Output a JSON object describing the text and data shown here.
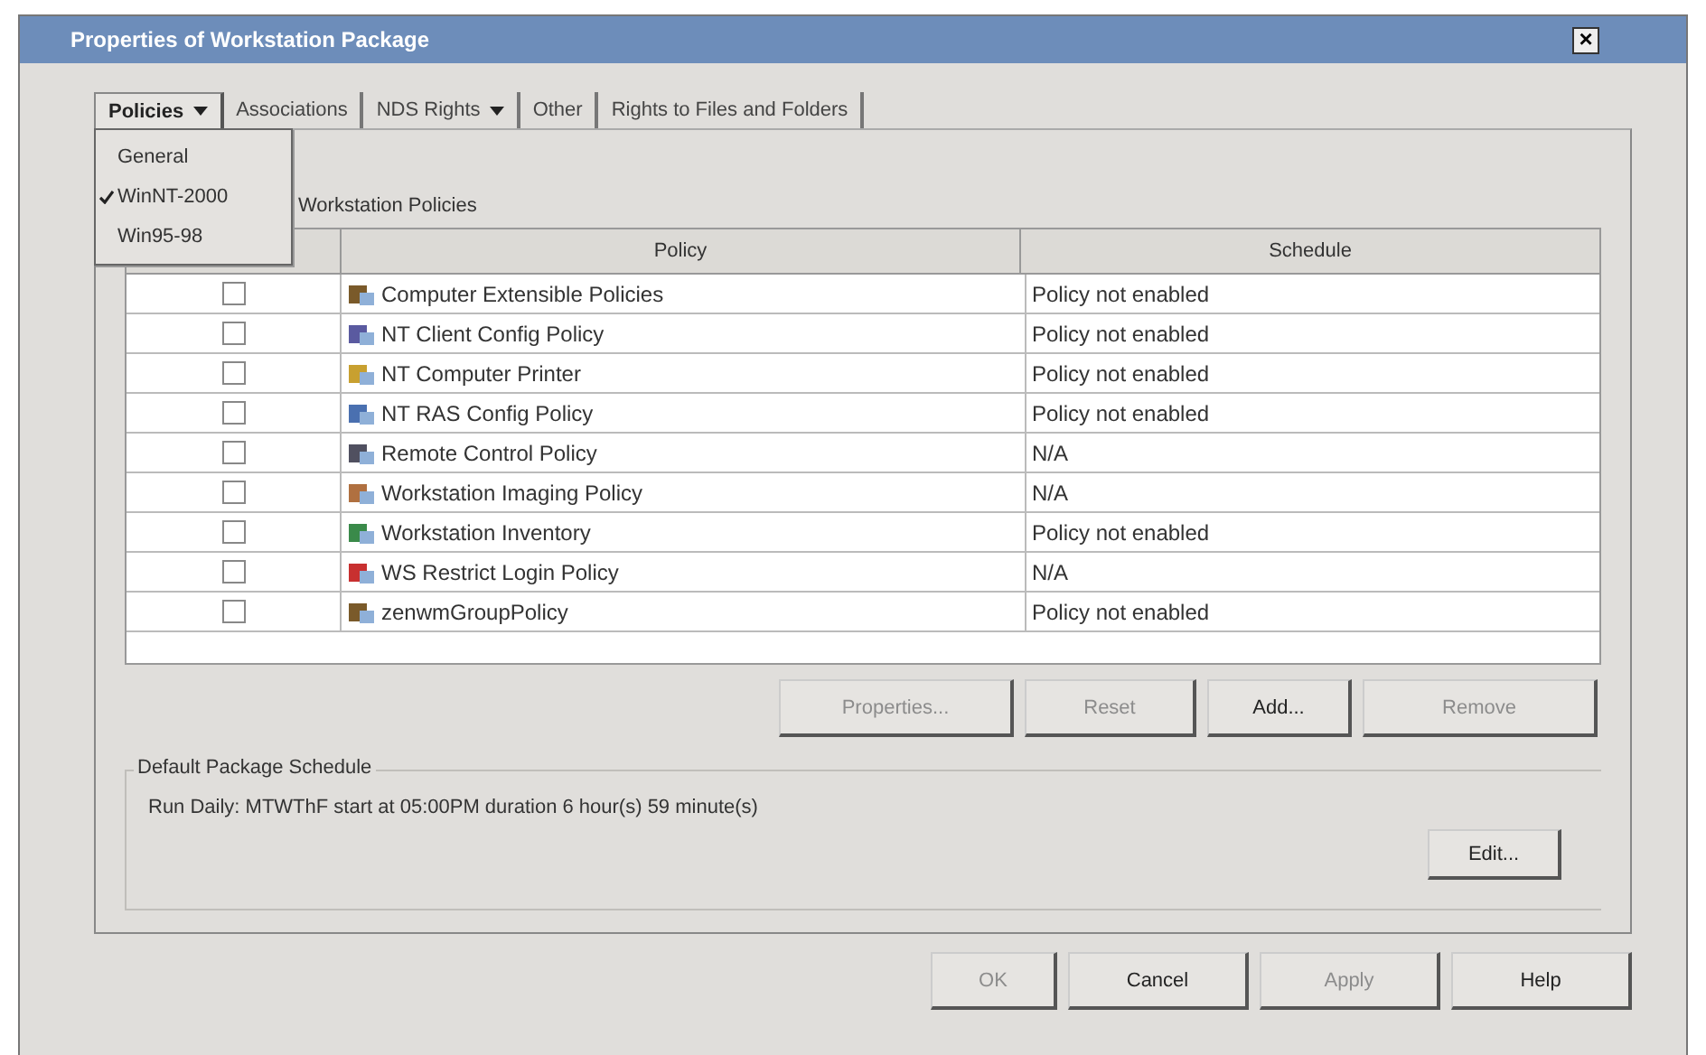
{
  "window": {
    "title": "Properties of Workstation Package",
    "close": "×"
  },
  "tabs": [
    {
      "label": "Policies",
      "dropdown": true,
      "selected": true
    },
    {
      "label": "Associations",
      "dropdown": false,
      "selected": false
    },
    {
      "label": "NDS Rights",
      "dropdown": true,
      "selected": false
    },
    {
      "label": "Other",
      "dropdown": false,
      "selected": false
    },
    {
      "label": "Rights to Files and Folders",
      "dropdown": false,
      "selected": false
    }
  ],
  "tab_menu": {
    "items": [
      {
        "label": "General",
        "checked": false
      },
      {
        "label": "WinNT-2000",
        "checked": true
      },
      {
        "label": "Win95-98",
        "checked": false
      }
    ]
  },
  "policies_group": {
    "label": "Workstation Policies"
  },
  "table": {
    "columns": [
      "Policy",
      "Schedule"
    ],
    "rows": [
      {
        "enabled": false,
        "policy": "Computer Extensible Policies",
        "schedule": "Policy not enabled"
      },
      {
        "enabled": false,
        "policy": "NT Client Config Policy",
        "schedule": "Policy not enabled"
      },
      {
        "enabled": false,
        "policy": "NT Computer Printer",
        "schedule": "Policy not enabled"
      },
      {
        "enabled": false,
        "policy": "NT RAS Config Policy",
        "schedule": "Policy not enabled"
      },
      {
        "enabled": false,
        "policy": "Remote Control Policy",
        "schedule": "N/A"
      },
      {
        "enabled": false,
        "policy": "Workstation Imaging Policy",
        "schedule": "N/A"
      },
      {
        "enabled": false,
        "policy": "Workstation Inventory",
        "schedule": "Policy not enabled"
      },
      {
        "enabled": false,
        "policy": "WS Restrict Login Policy",
        "schedule": "N/A"
      },
      {
        "enabled": false,
        "policy": "zenwmGroupPolicy",
        "schedule": "Policy not enabled"
      }
    ]
  },
  "table_buttons": [
    {
      "label": "Properties...",
      "disabled": true
    },
    {
      "label": "Reset",
      "disabled": true
    },
    {
      "label": "Add...",
      "disabled": false
    },
    {
      "label": "Remove",
      "disabled": true
    }
  ],
  "schedule_group": {
    "label": "Default Package Schedule",
    "text": "Run Daily: MTWThF start at 05:00PM duration 6 hour(s) 59 minute(s)",
    "edit_button": "Edit..."
  },
  "dialog_buttons": [
    {
      "label": "OK",
      "disabled": true
    },
    {
      "label": "Cancel",
      "disabled": false
    },
    {
      "label": "Apply",
      "disabled": true
    },
    {
      "label": "Help",
      "disabled": false
    }
  ]
}
